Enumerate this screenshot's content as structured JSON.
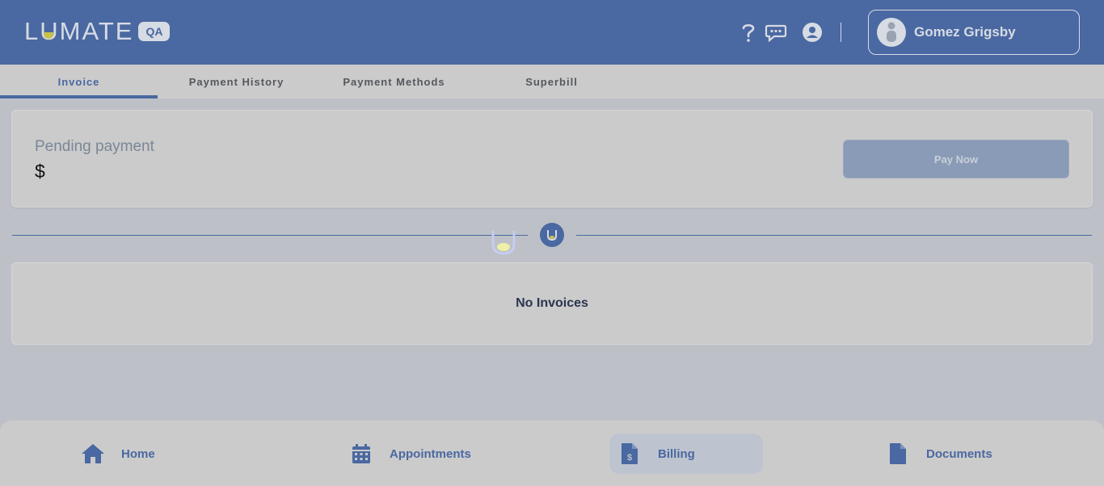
{
  "header": {
    "logo_text": "LUMATE",
    "env_badge": "QA",
    "user_name": "Gomez Grigsby",
    "icons": [
      "help-icon",
      "chat-icon",
      "account-circle-icon"
    ]
  },
  "tabs": [
    {
      "label": "Invoice",
      "active": true
    },
    {
      "label": "Payment History",
      "active": false
    },
    {
      "label": "Payment Methods",
      "active": false
    },
    {
      "label": "Superbill",
      "active": false
    }
  ],
  "pending": {
    "label": "Pending payment",
    "amount": "$",
    "pay_button": "Pay Now"
  },
  "invoices": {
    "empty_text": "No Invoices"
  },
  "bottom_nav": [
    {
      "label": "Home",
      "icon": "home-icon",
      "active": false
    },
    {
      "label": "Appointments",
      "icon": "calendar-icon",
      "active": false
    },
    {
      "label": "Billing",
      "icon": "billing-icon",
      "active": true
    },
    {
      "label": "Documents",
      "icon": "document-icon",
      "active": false
    }
  ],
  "colors": {
    "brand": "#4a68a1",
    "accent_yellow": "#c8c24c",
    "overlay_bg": "#bdc1c7"
  }
}
